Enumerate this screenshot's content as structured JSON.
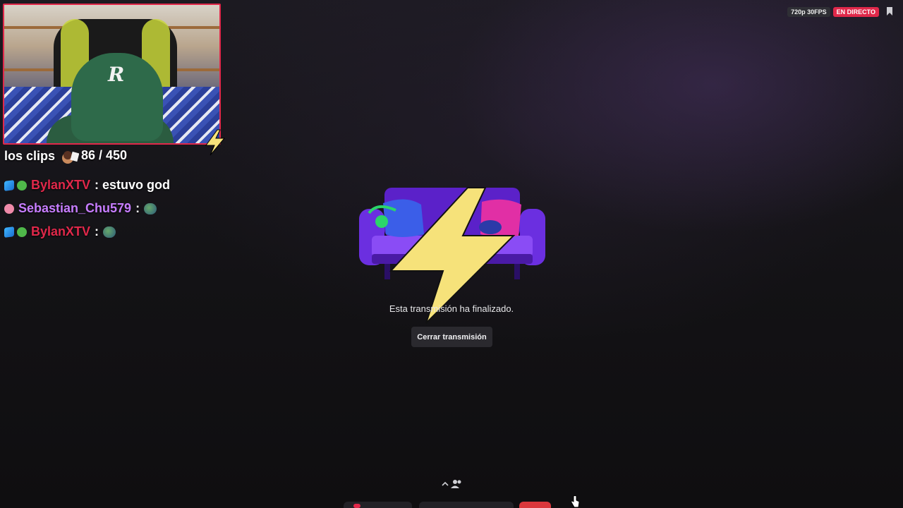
{
  "overlay": {
    "clips_title": "los clips",
    "clips_count": "86 / 450"
  },
  "chat": [
    {
      "user": "BylanXTV",
      "user_color": "#e0284a",
      "message": ": estuvo god"
    },
    {
      "user": "Sebastian_Chu579",
      "user_color": "#c77dff",
      "message": ":"
    },
    {
      "user": "BylanXTV",
      "user_color": "#e0284a",
      "message": ":"
    }
  ],
  "stream": {
    "quality": "720p 30FPS",
    "live_label": "EN DIRECTO",
    "ended_message": "Esta transmisión ha finalizado.",
    "close_button": "Cerrar transmisión"
  },
  "colors": {
    "accent_red": "#e0284a",
    "bolt_yellow": "#f6e27a"
  },
  "icons": {
    "bookmark": "bookmark-icon",
    "people": "people-icon",
    "chevron": "chevron-up-icon"
  }
}
